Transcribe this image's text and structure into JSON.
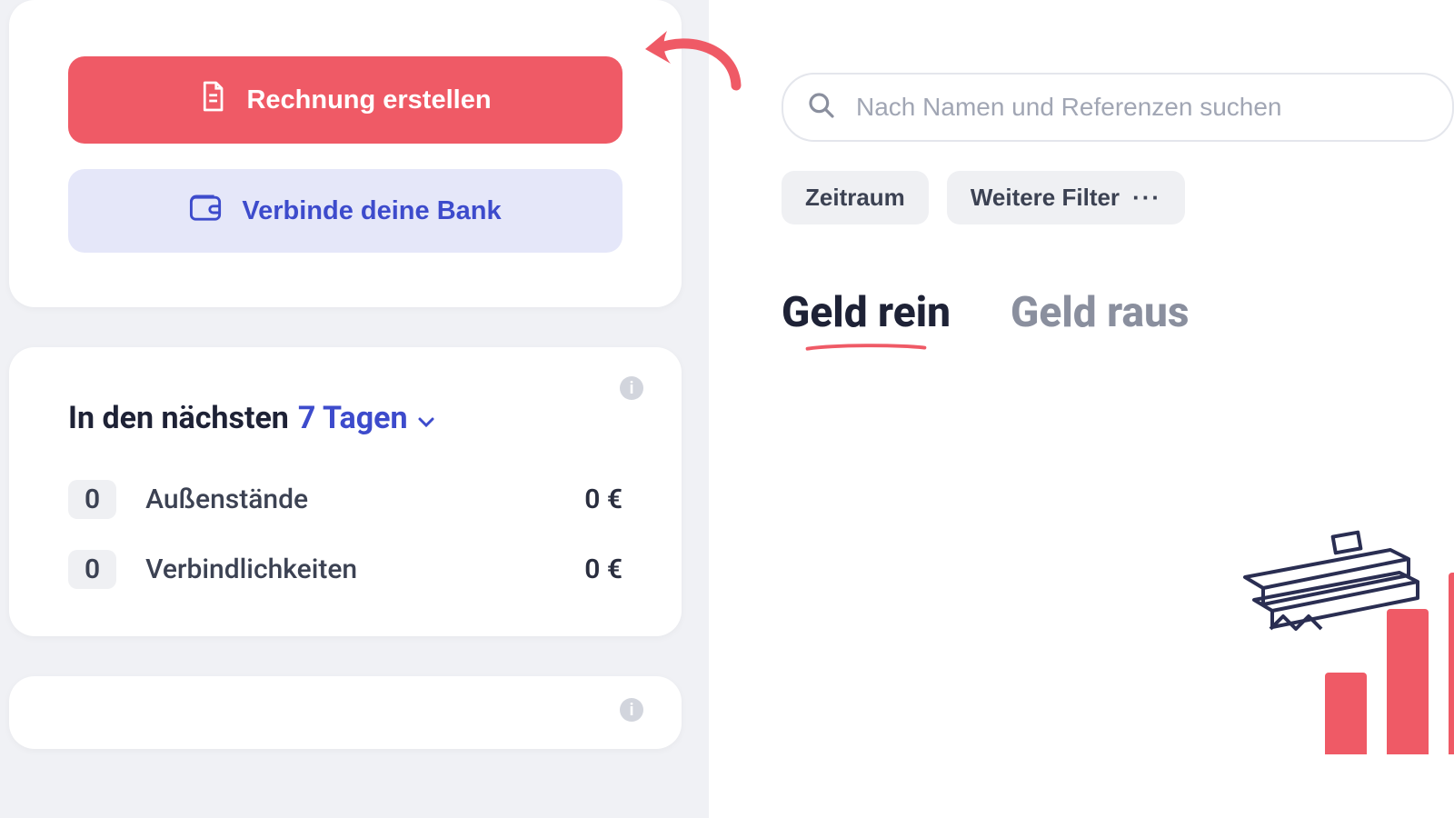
{
  "actions": {
    "create_invoice_label": "Rechnung erstellen",
    "connect_bank_label": "Verbinde deine Bank"
  },
  "period": {
    "prefix_label": "In den nächsten",
    "value_label": "7 Tagen"
  },
  "stats": {
    "receivables": {
      "count": "0",
      "label": "Außenstände",
      "amount": "0 €"
    },
    "payables": {
      "count": "0",
      "label": "Verbindlichkeiten",
      "amount": "0 €"
    }
  },
  "search": {
    "placeholder": "Nach Namen und Referenzen suchen"
  },
  "filters": {
    "period_label": "Zeitraum",
    "more_label": "Weitere Filter"
  },
  "tabs": {
    "money_in_label": "Geld rein",
    "money_out_label": "Geld raus",
    "active": "money_in"
  }
}
